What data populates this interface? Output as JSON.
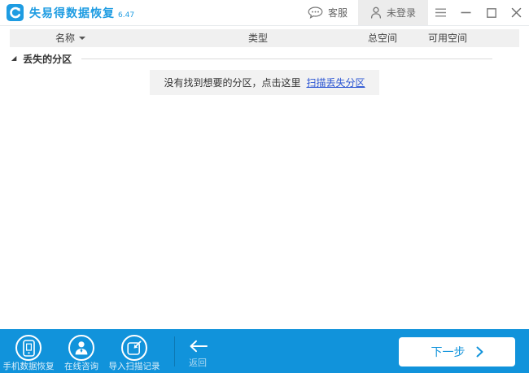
{
  "titlebar": {
    "app_title": "失易得数据恢复",
    "version": "6.47",
    "support": "客服",
    "login": "未登录"
  },
  "table": {
    "columns": [
      "名称",
      "类型",
      "总空间",
      "可用空间"
    ]
  },
  "tree": {
    "lost_partition_group": "丢失的分区"
  },
  "empty": {
    "message": "没有找到想要的分区，点击这里",
    "link": "扫描丢失分区"
  },
  "footer": {
    "actions": [
      {
        "label": "手机数据恢复",
        "icon": "phone-recovery-icon"
      },
      {
        "label": "在线咨询",
        "icon": "online-consult-icon"
      },
      {
        "label": "导入扫描记录",
        "icon": "import-record-icon"
      }
    ],
    "back": "返回",
    "next": "下一步"
  },
  "colors": {
    "footer_blue": "#1193db",
    "brand_blue": "#1e9ce2",
    "link_blue": "#2b55d3",
    "header_bg": "#f0f0f0",
    "login_bg": "#ececec"
  }
}
